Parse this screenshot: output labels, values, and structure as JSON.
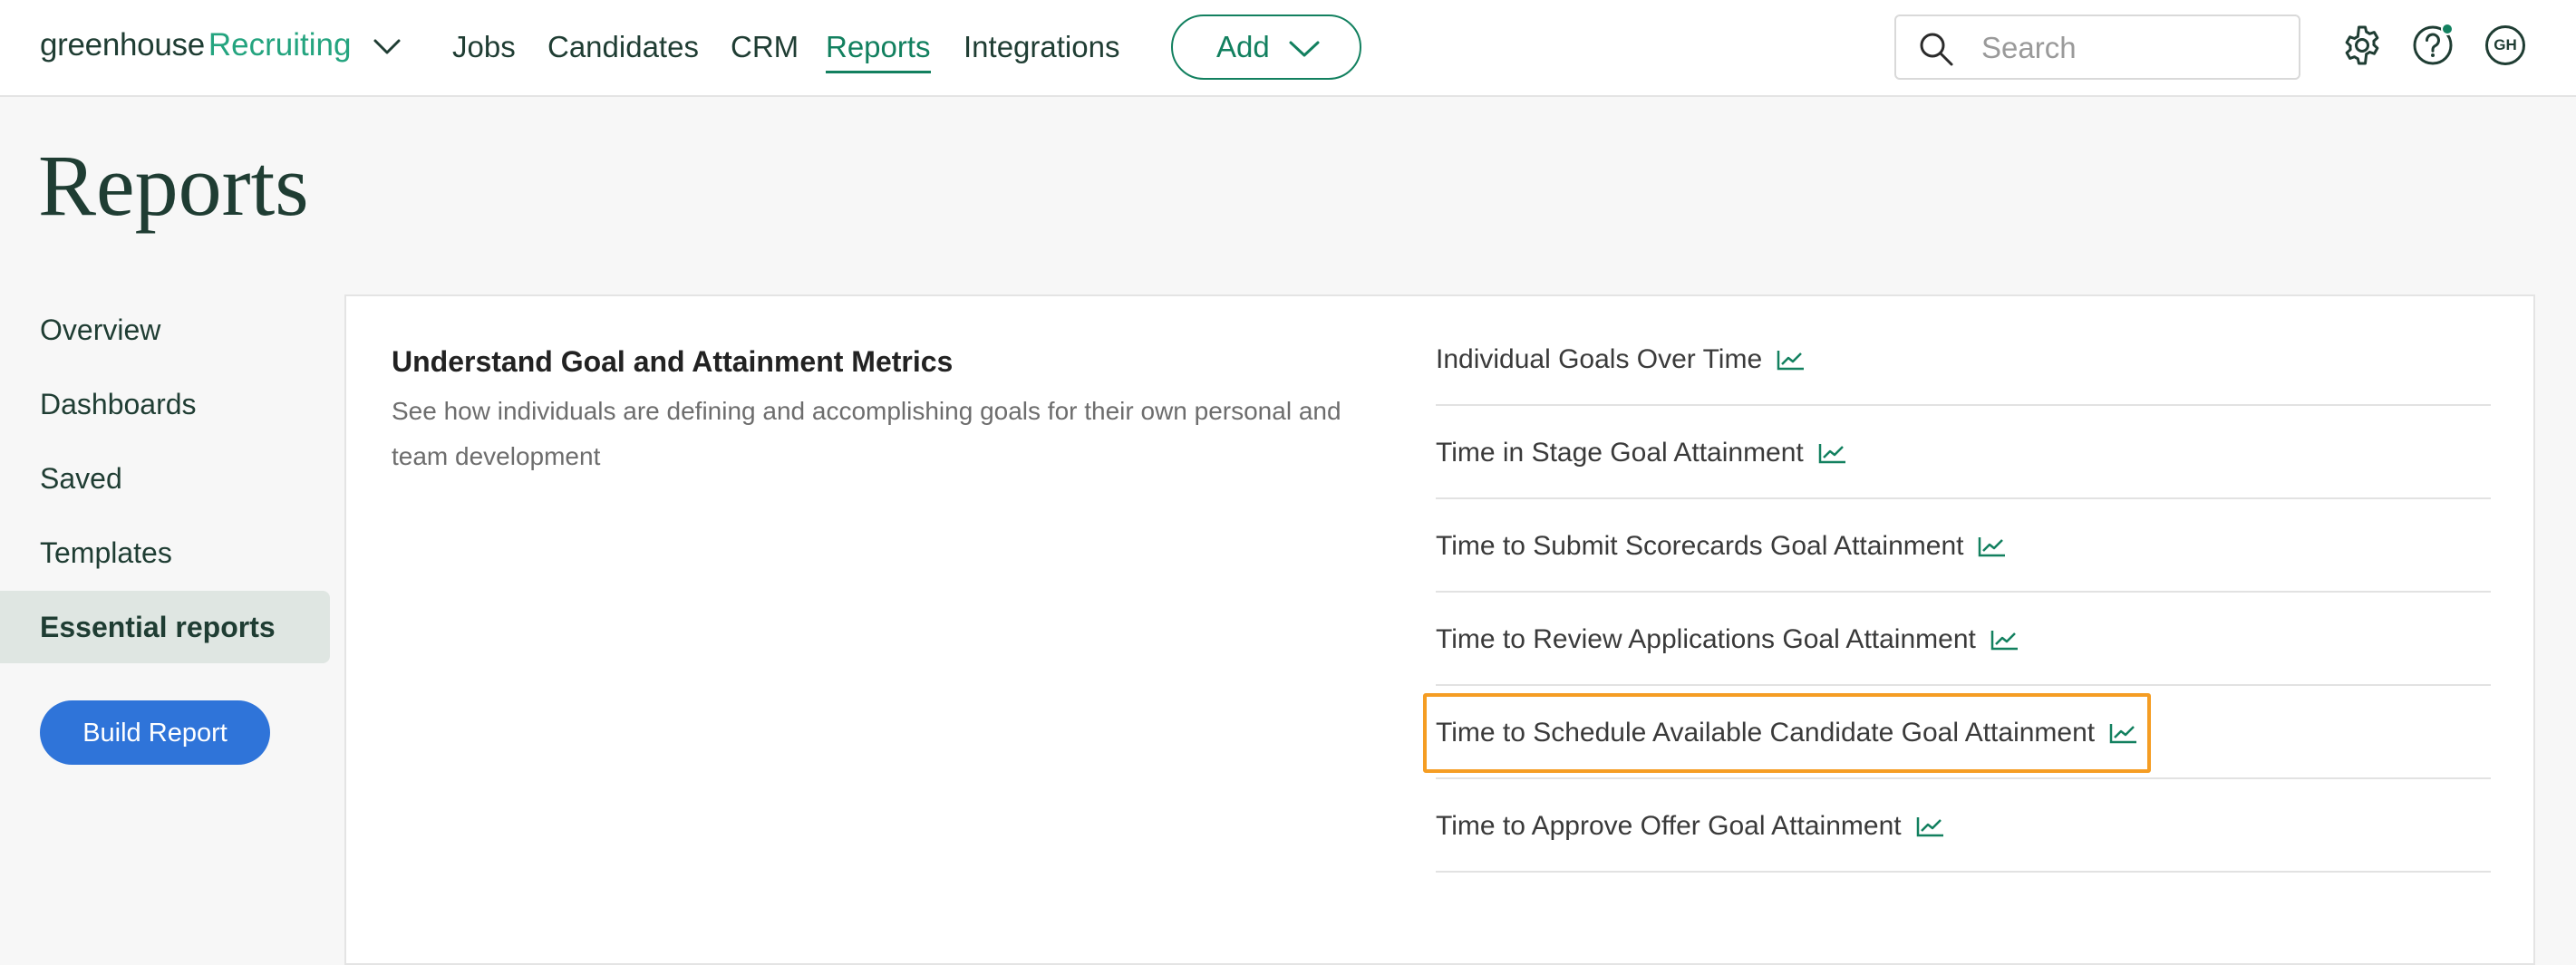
{
  "brand": {
    "name_part1": "greenhouse",
    "name_part2": "Recruiting"
  },
  "nav": {
    "items": [
      {
        "label": "Jobs",
        "active": false
      },
      {
        "label": "Candidates",
        "active": false
      },
      {
        "label": "CRM",
        "active": false
      },
      {
        "label": "Reports",
        "active": true
      },
      {
        "label": "Integrations",
        "active": false
      }
    ],
    "add_label": "Add"
  },
  "search": {
    "placeholder": "Search",
    "value": ""
  },
  "user": {
    "initials": "GH"
  },
  "colors": {
    "brand_green": "#12805f",
    "dark_green": "#1f3d33",
    "primary_blue": "#2f74d9",
    "highlight_orange": "#f59d23",
    "notification_dot": "#12805f"
  },
  "icons": {
    "brand_menu": "chevron-down-icon",
    "add_menu": "chevron-down-icon",
    "search": "search-icon",
    "settings": "gear-icon",
    "help": "help-icon",
    "report_type": "line-chart-icon"
  },
  "page": {
    "title": "Reports"
  },
  "sidebar": {
    "items": [
      {
        "label": "Overview",
        "active": false
      },
      {
        "label": "Dashboards",
        "active": false
      },
      {
        "label": "Saved",
        "active": false
      },
      {
        "label": "Templates",
        "active": false
      },
      {
        "label": "Essential reports",
        "active": true
      }
    ],
    "build_report_label": "Build Report"
  },
  "section": {
    "title": "Understand Goal and Attainment Metrics",
    "description": "See how individuals are defining and accomplishing goals for their own personal and team development",
    "reports": [
      {
        "label": "Individual Goals Over Time",
        "highlighted": false
      },
      {
        "label": "Time in Stage Goal Attainment",
        "highlighted": false
      },
      {
        "label": "Time to Submit Scorecards Goal Attainment",
        "highlighted": false
      },
      {
        "label": "Time to Review Applications Goal Attainment",
        "highlighted": false
      },
      {
        "label": "Time to Schedule Available Candidate Goal Attainment",
        "highlighted": true
      },
      {
        "label": "Time to Approve Offer Goal Attainment",
        "highlighted": false
      }
    ]
  }
}
